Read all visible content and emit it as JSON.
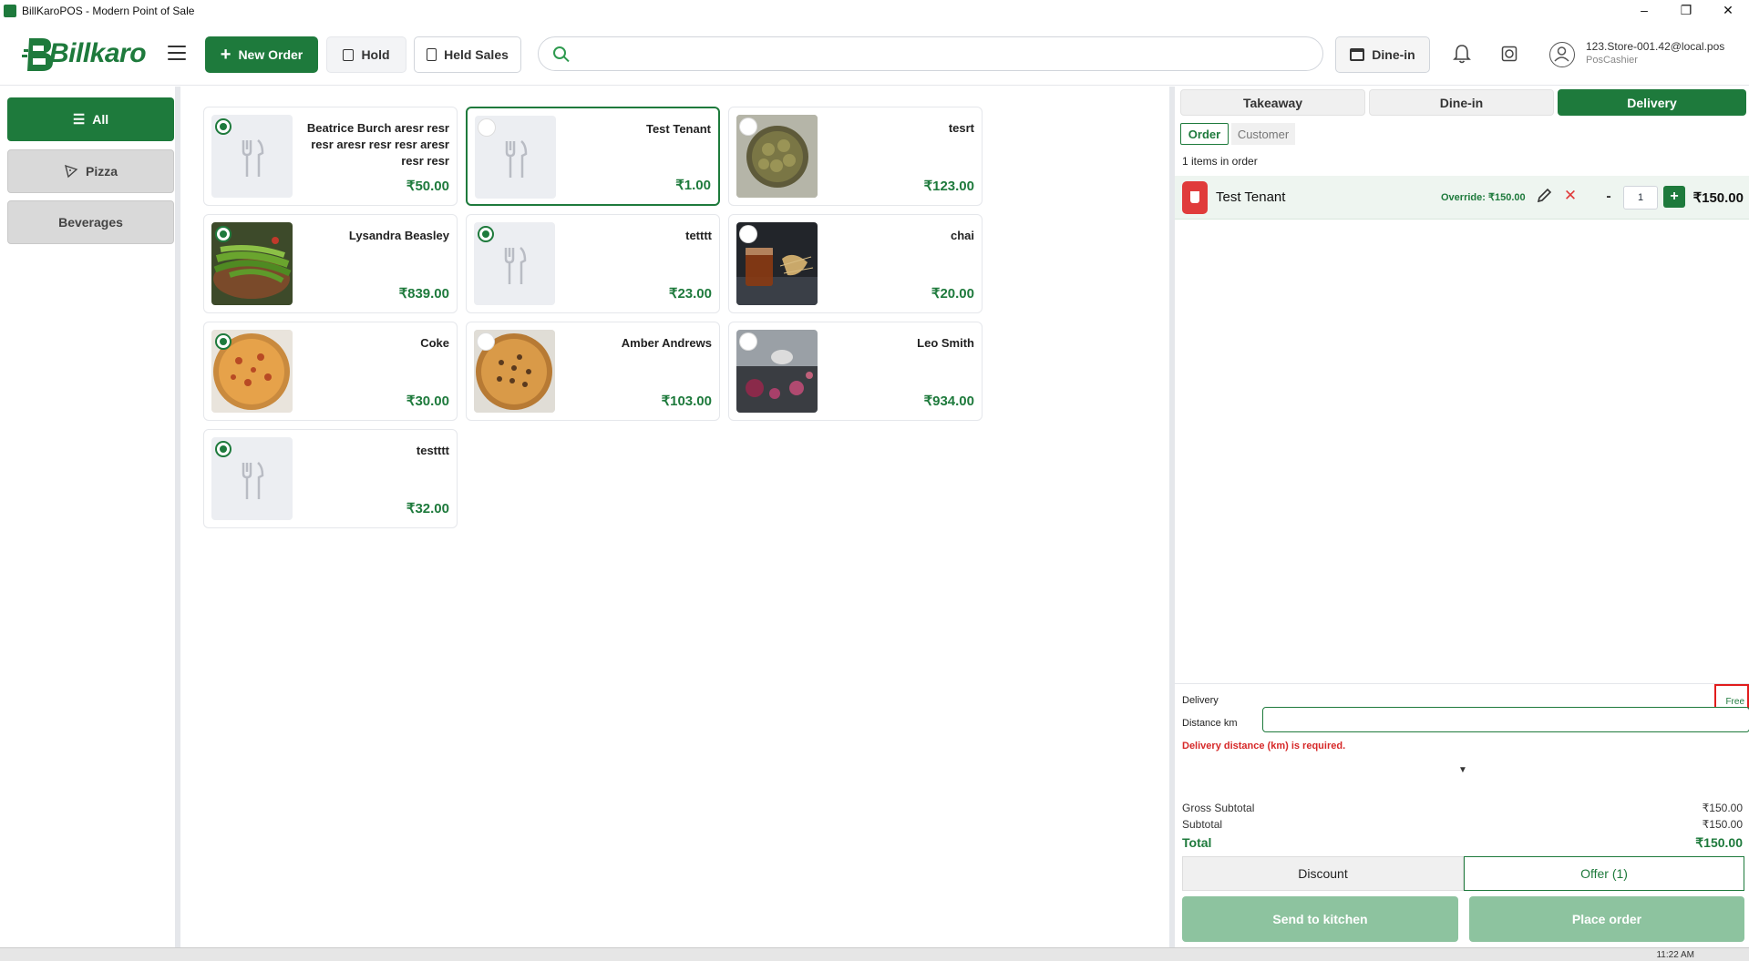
{
  "window": {
    "title": "BillKaroPOS - Modern Point of Sale"
  },
  "header": {
    "logo_text": "Billkaro",
    "new_order_label": "New Order",
    "hold_label": "Hold",
    "held_sales_label": "Held Sales",
    "search_value": "",
    "search_placeholder": "",
    "dine_in_label": "Dine-in",
    "user_email": "123.Store-001.42@local.pos",
    "user_role": "PosCashier"
  },
  "categories": [
    {
      "label": "All",
      "active": true
    },
    {
      "label": "Pizza",
      "active": false
    },
    {
      "label": "Beverages",
      "active": false
    }
  ],
  "products": [
    {
      "name": "Beatrice Burch  aresr resr resr aresr resr resr aresr resr resr",
      "price": "₹50.00",
      "image": "placeholder",
      "radio": "on"
    },
    {
      "name": "Test Tenant",
      "price": "₹1.00",
      "image": "placeholder",
      "radio": "off",
      "selected": true
    },
    {
      "name": "tesrt",
      "price": "₹123.00",
      "image": "dumplings",
      "radio": "off"
    },
    {
      "name": "Lysandra Beasley",
      "price": "₹839.00",
      "image": "chilies",
      "radio": "on"
    },
    {
      "name": "tetttt",
      "price": "₹23.00",
      "image": "placeholder",
      "radio": "on"
    },
    {
      "name": "chai",
      "price": "₹20.00",
      "image": "tea",
      "radio": "off"
    },
    {
      "name": "Coke",
      "price": "₹30.00",
      "image": "pizza",
      "radio": "on"
    },
    {
      "name": "Amber Andrews",
      "price": "₹103.00",
      "image": "pizza2",
      "radio": "off"
    },
    {
      "name": "Leo Smith",
      "price": "₹934.00",
      "image": "onions",
      "radio": "off"
    },
    {
      "name": "testttt",
      "price": "₹32.00",
      "image": "placeholder",
      "radio": "on"
    }
  ],
  "order": {
    "tabs": [
      "Takeaway",
      "Dine-in",
      "Delivery"
    ],
    "active_tab": "Delivery",
    "subtabs": [
      "Order",
      "Customer"
    ],
    "items_count": "1 items in order",
    "line": {
      "name": "Test Tenant",
      "override": "Override: ₹150.00",
      "qty_minus": "-",
      "qty": "1",
      "qty_plus": "+",
      "price": "₹150.00"
    },
    "delivery": {
      "label": "Delivery",
      "fee": "Free",
      "distance_label": "Distance km",
      "distance_value": "",
      "error": "Delivery distance (km) is required."
    },
    "totals": {
      "gross_label": "Gross Subtotal",
      "gross": "₹150.00",
      "subtotal_label": "Subtotal",
      "subtotal": "₹150.00",
      "total_label": "Total",
      "total": "₹150.00"
    },
    "discount_label": "Discount",
    "offer_label": "Offer (1)",
    "send_kitchen_label": "Send to kitchen",
    "place_order_label": "Place order"
  },
  "taskbar": {
    "clock": "11:22 AM"
  },
  "colors": {
    "brand": "#1e7a3c",
    "error": "#d62828",
    "disabled": "#8dc39f"
  }
}
